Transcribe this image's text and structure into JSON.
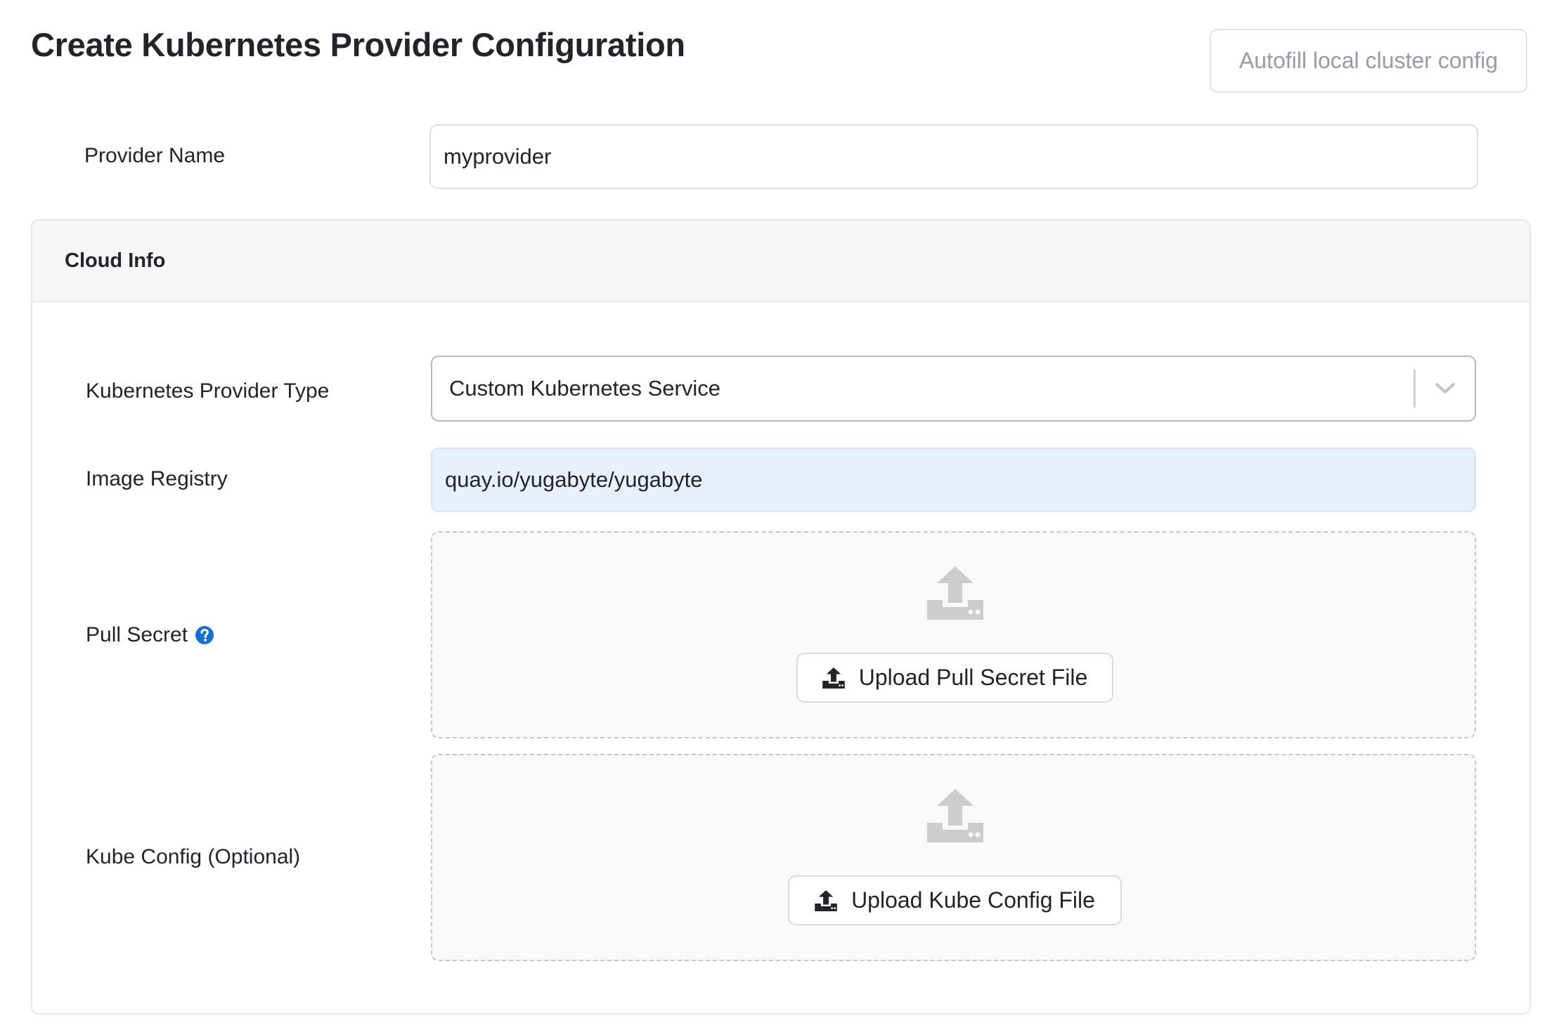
{
  "header": {
    "title": "Create Kubernetes Provider Configuration",
    "autofill_label": "Autofill local cluster config"
  },
  "provider_name": {
    "label": "Provider Name",
    "value": "myprovider"
  },
  "cloud_info": {
    "title": "Cloud Info",
    "provider_type": {
      "label": "Kubernetes Provider Type",
      "selected": "Custom Kubernetes Service"
    },
    "image_registry": {
      "label": "Image Registry",
      "value": "quay.io/yugabyte/yugabyte"
    },
    "pull_secret": {
      "label": "Pull Secret",
      "upload_label": "Upload Pull Secret File"
    },
    "kube_config": {
      "label": "Kube Config (Optional)",
      "upload_label": "Upload Kube Config File"
    }
  },
  "colors": {
    "accent_blue": "#1a6fd1",
    "autofill_bg": "#e8f0fe",
    "upload_icon_gray": "#cccccc"
  },
  "icons": [
    "question-circle-icon",
    "chevron-down-icon",
    "upload-icon"
  ]
}
